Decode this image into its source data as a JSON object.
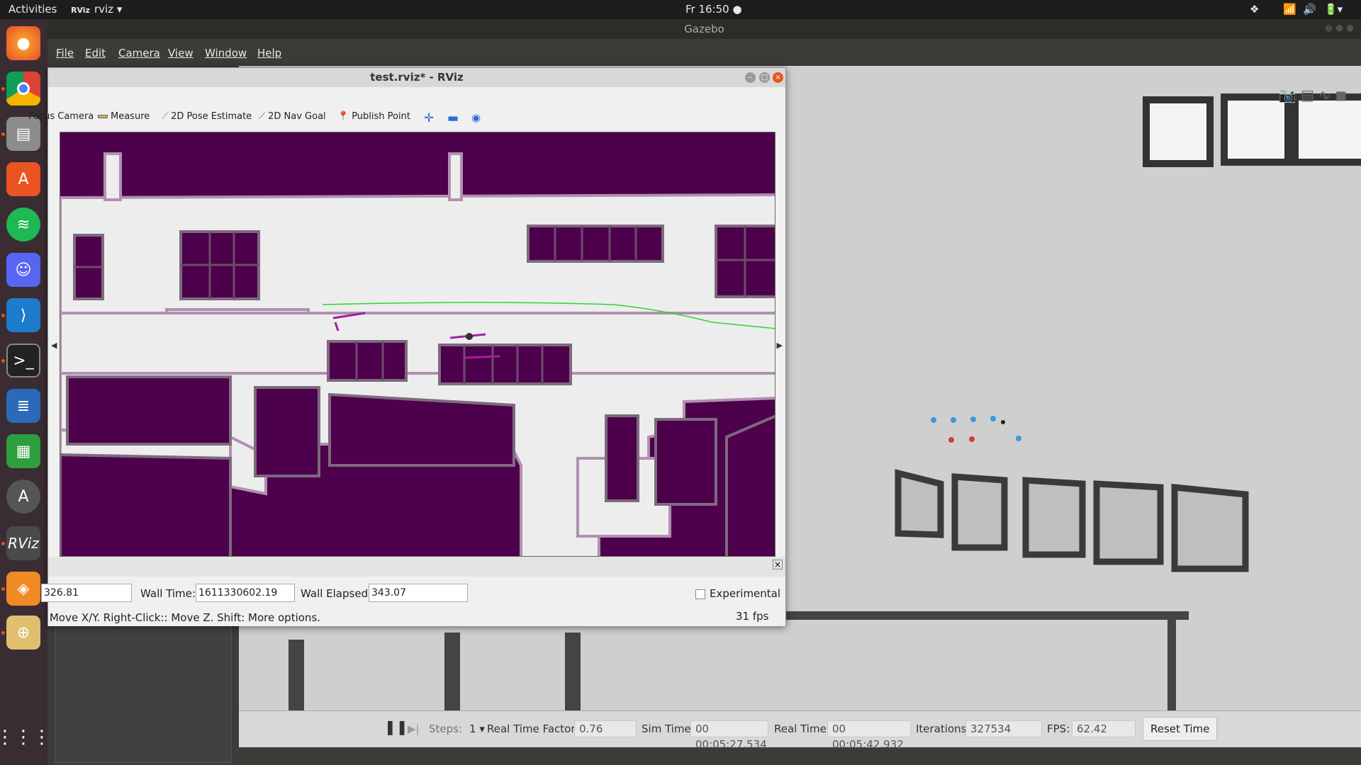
{
  "topbar": {
    "activities": "Activities",
    "app_name": "rviz",
    "clock": "Fr 16:50"
  },
  "gazebo": {
    "title": "Gazebo",
    "menu": [
      "File",
      "Edit",
      "Camera",
      "View",
      "Window",
      "Help"
    ],
    "bottom": {
      "steps_label": "Steps:",
      "steps_value": "1",
      "rtf_label": "Real Time Factor:",
      "rtf_value": "0.76",
      "sim_label": "Sim Time:",
      "sim_value": "00 00:05:27.534",
      "real_label": "Real Time:",
      "real_value": "00 00:05:42.932",
      "iter_label": "Iterations:",
      "iter_value": "327534",
      "fps_label": "FPS:",
      "fps_value": "62.42",
      "reset_label": "Reset Time"
    }
  },
  "rviz": {
    "title": "test.rviz* - RViz",
    "toolbar": {
      "focus": "Focus Camera",
      "measure": "Measure",
      "pose": "2D Pose Estimate",
      "nav": "2D Nav Goal",
      "publish": "Publish Point"
    },
    "status": {
      "ros_elapsed_value": "326.81",
      "wall_time_label": "Wall Time:",
      "wall_time_value": "1611330602.19",
      "wall_elapsed_label": "Wall Elapsed:",
      "wall_elapsed_value": "343.07",
      "experimental_label": "Experimental",
      "help_text": ": Move X/Y. Right-Click:: Move Z. Shift: More options.",
      "fps": "31 fps"
    }
  },
  "dock": {
    "icons": [
      "firefox-icon",
      "chrome-icon",
      "files-icon",
      "software-icon",
      "spotify-icon",
      "discord-icon",
      "vscode-icon",
      "terminal-icon",
      "writer-icon",
      "calc-icon",
      "updater-icon",
      "rviz-icon",
      "layers-icon",
      "map-icon",
      "apps-grid-icon"
    ],
    "rviz_label": "RViz"
  },
  "colors": {
    "map_obstacle": "#4d004b",
    "map_free": "#ededed",
    "path": "#32d232",
    "accent": "#e95420"
  }
}
